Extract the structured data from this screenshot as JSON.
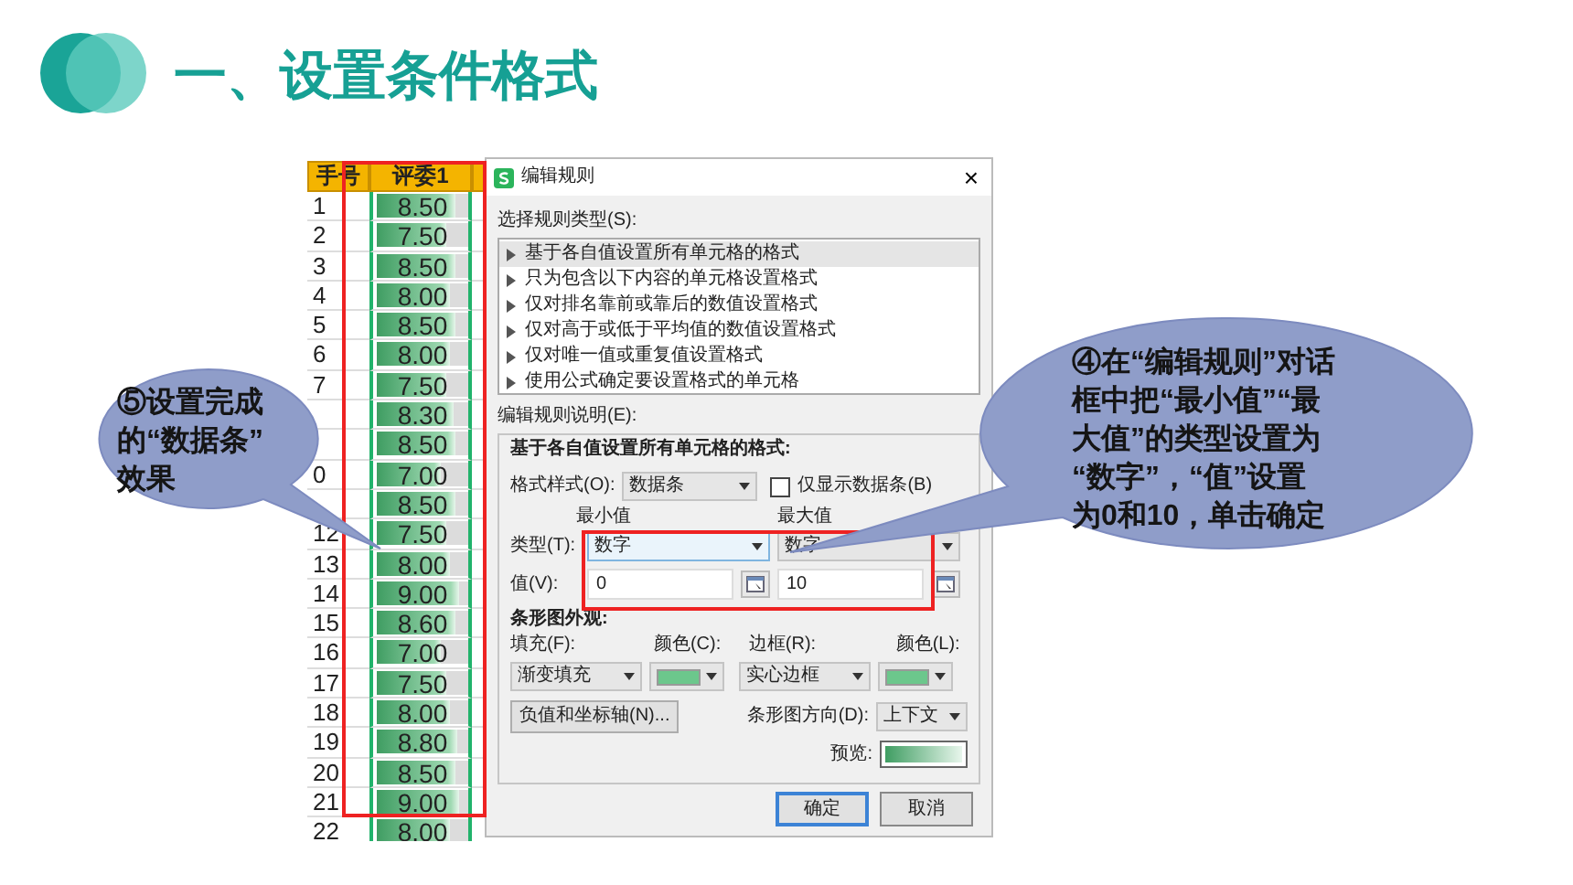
{
  "slide": {
    "title": "一、设置条件格式"
  },
  "sheet": {
    "headers": [
      "手号",
      "评委1"
    ],
    "rows": [
      {
        "num": "1",
        "value": "8.50",
        "level": 0.85
      },
      {
        "num": "2",
        "value": "7.50",
        "level": 0.75
      },
      {
        "num": "3",
        "value": "8.50",
        "level": 0.85
      },
      {
        "num": "4",
        "value": "8.00",
        "level": 0.8
      },
      {
        "num": "5",
        "value": "8.50",
        "level": 0.85
      },
      {
        "num": "6",
        "value": "8.00",
        "level": 0.8
      },
      {
        "num": "7",
        "value": "7.50",
        "level": 0.75
      },
      {
        "value": "8.30",
        "level": 0.83
      },
      {
        "value": "8.50",
        "level": 0.85
      },
      {
        "num": "0",
        "value": "7.00",
        "level": 0.7
      },
      {
        "value": "8.50",
        "level": 0.85
      },
      {
        "num": "12",
        "value": "7.50",
        "level": 0.75
      },
      {
        "num": "13",
        "value": "8.00",
        "level": 0.8
      },
      {
        "num": "14",
        "value": "9.00",
        "level": 0.9
      },
      {
        "num": "15",
        "value": "8.60",
        "level": 0.86
      },
      {
        "num": "16",
        "value": "7.00",
        "level": 0.7
      },
      {
        "num": "17",
        "value": "7.50",
        "level": 0.75
      },
      {
        "num": "18",
        "value": "8.00",
        "level": 0.8
      },
      {
        "num": "19",
        "value": "8.80",
        "level": 0.88
      },
      {
        "num": "20",
        "value": "8.50",
        "level": 0.85
      },
      {
        "num": "21",
        "value": "9.00",
        "level": 0.9
      },
      {
        "num": "22",
        "value": "8.00",
        "level": 0.8
      }
    ]
  },
  "dialog": {
    "title": "编辑规则",
    "close": "×",
    "rule_type_label": "选择规则类型(S):",
    "rule_types": [
      {
        "label": "基于各自值设置所有单元格的格式",
        "selected": true
      },
      {
        "label": "只为包含以下内容的单元格设置格式",
        "selected": false
      },
      {
        "label": "仅对排名靠前或靠后的数值设置格式",
        "selected": false
      },
      {
        "label": "仅对高于或低于平均值的数值设置格式",
        "selected": false
      },
      {
        "label": "仅对唯一值或重复值设置格式",
        "selected": false
      },
      {
        "label": "使用公式确定要设置格式的单元格",
        "selected": false
      }
    ],
    "description_label": "编辑规则说明(E):",
    "group_title": "基于各自值设置所有单元格的格式:",
    "style_label": "格式样式(O):",
    "style_value": "数据条",
    "only_bar": {
      "label": "仅显示数据条(B)",
      "checked": false
    },
    "min_header": "最小值",
    "max_header": "最大值",
    "type_label": "类型(T):",
    "min_type": "数字",
    "max_type": "数字",
    "value_label": "值(V):",
    "min_value": "0",
    "max_value": "10",
    "appearance_label": "条形图外观:",
    "fill_label": "填充(F):",
    "fill_color_label": "颜色(C):",
    "border_label": "边框(R):",
    "border_color_label": "颜色(L):",
    "fill_value": "渐变填充",
    "fill_swatch": {
      "color": "#6cc78c"
    },
    "border_value": "实心边框",
    "border_swatch": {
      "color": "#6cc78c"
    },
    "axis_button": "负值和坐标轴(N)...",
    "direction_label": "条形图方向(D):",
    "direction_value": "上下文",
    "preview_label": "预览:",
    "ok": "确定",
    "cancel": "取消"
  },
  "callouts": [
    {
      "lines": [
        "⑤设置完成",
        "的“数据条”",
        "效果"
      ]
    },
    {
      "lines": [
        "④在“编辑规则”对话",
        "框中把“最小值”“最",
        "大值”的类型设置为",
        "“数字”，“值”设置",
        "为0和10，单击确定"
      ]
    }
  ]
}
